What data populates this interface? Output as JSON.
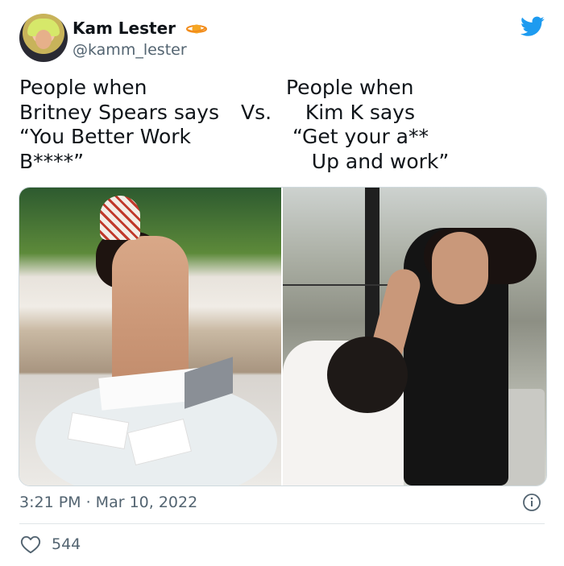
{
  "tweet": {
    "display_name": "Kam Lester",
    "handle": "@kamm_lester",
    "badge_icon": "planet-emoji-icon",
    "platform_icon": "twitter-bird-icon",
    "accent_color": "#1d9bf0"
  },
  "caption": {
    "left": "People when\nBritney Spears says\n“You Better Work\nB****”",
    "vs": "Vs.",
    "right": "People when\n   Kim K says\n “Get your a**\n    Up and work”"
  },
  "footer": {
    "timestamp": "3:21 PM · Mar 10, 2022",
    "info_icon": "info-icon",
    "like_icon": "heart-icon",
    "like_count": "544"
  }
}
